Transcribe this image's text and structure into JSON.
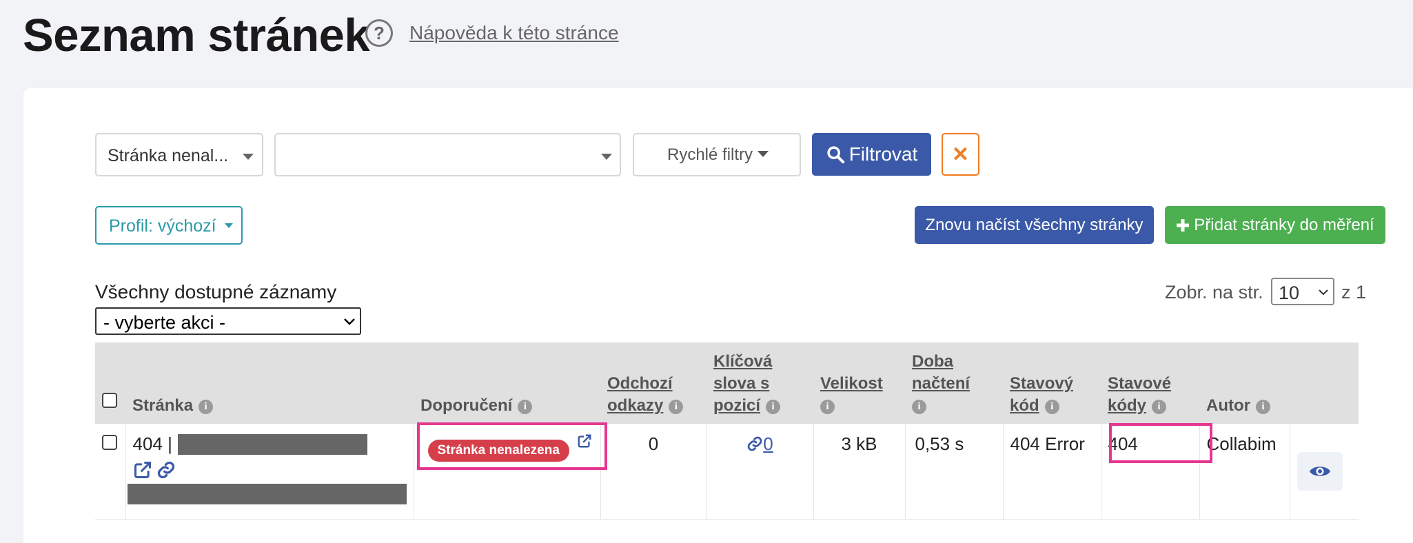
{
  "header": {
    "title": "Seznam stránek",
    "help_symbol": "?",
    "help_link": "Nápověda k této stránce"
  },
  "filters": {
    "filter_select": "Stránka nenal...",
    "value_select": "",
    "quick_filters": "Rychlé filtry",
    "filter_button": "Filtrovat",
    "clear_symbol": "✕"
  },
  "profile": {
    "label": "Profil: výchozí"
  },
  "actions": {
    "reload_all": "Znovu načíst všechny stránky",
    "add_pages": "Přidat stránky do měření"
  },
  "records": {
    "label": "Všechny dostupné záznamy",
    "bulk_action": "- vyberte akci -"
  },
  "paging": {
    "per_page_label": "Zobr. na str.",
    "per_page_value": "10",
    "of_label": "z 1"
  },
  "table": {
    "headers": {
      "page": "Stránka",
      "recommendation": "Doporučení",
      "outgoing": [
        "Odchozí",
        "odkazy"
      ],
      "keywords": [
        "Klíčová",
        "slova s",
        "pozicí"
      ],
      "size": "Velikost",
      "load_time": [
        "Doba",
        "načtení"
      ],
      "status_code": [
        "Stavový",
        "kód"
      ],
      "status_codes": [
        "Stavové",
        "kódy"
      ],
      "author": "Autor"
    },
    "row": {
      "page_prefix": "404 |",
      "recommendation_badge": "Stránka nenalezena",
      "outgoing": "0",
      "keywords": "0",
      "size": "3 kB",
      "load_time": "0,53 s",
      "status_code": "404 Error",
      "status_codes": "404",
      "author": "Collabim"
    }
  },
  "colors": {
    "primary": "#3a59a8",
    "success": "#4caf50",
    "teal": "#2a9aa8",
    "danger": "#d63f4a",
    "highlight": "#e5378f",
    "orange": "#f07c21"
  },
  "icons": [
    "help-icon",
    "search-icon",
    "close-icon",
    "plus-icon",
    "info-icon",
    "external-link-icon",
    "link-icon",
    "eye-icon"
  ]
}
